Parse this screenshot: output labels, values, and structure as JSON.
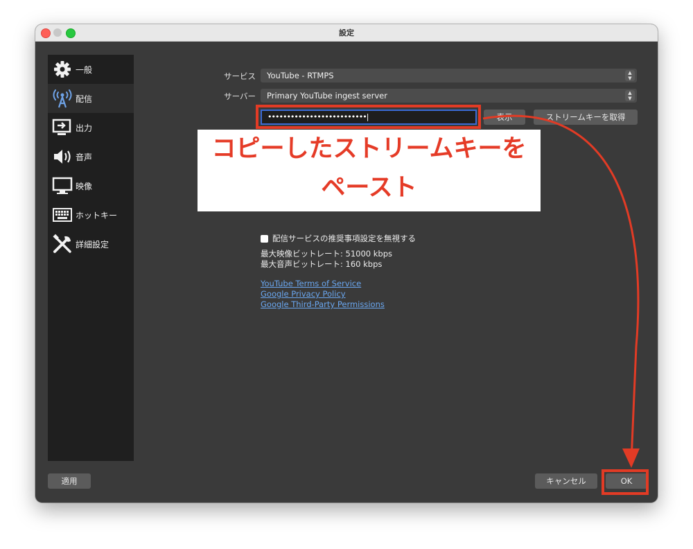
{
  "window": {
    "title": "設定"
  },
  "sidebar": {
    "items": [
      {
        "label": "一般",
        "icon": "gear-icon"
      },
      {
        "label": "配信",
        "icon": "antenna-icon"
      },
      {
        "label": "出力",
        "icon": "output-icon"
      },
      {
        "label": "音声",
        "icon": "speaker-icon"
      },
      {
        "label": "映像",
        "icon": "monitor-icon"
      },
      {
        "label": "ホットキー",
        "icon": "keyboard-icon"
      },
      {
        "label": "詳細設定",
        "icon": "tools-icon"
      }
    ],
    "active_index": 1
  },
  "stream": {
    "service_label": "サービス",
    "service_value": "YouTube - RTMPS",
    "server_label": "サーバー",
    "server_value": "Primary YouTube ingest server",
    "key_value": "••••••••••••••••••••••••••|",
    "show_button": "表示",
    "get_key_button": "ストリームキーを取得",
    "ignore_checkbox_label": "配信サービスの推奨事項設定を無視する",
    "max_video_bitrate": "最大映像ビットレート: 51000 kbps",
    "max_audio_bitrate": "最大音声ビットレート: 160 kbps",
    "links": [
      "YouTube Terms of Service",
      "Google Privacy Policy",
      "Google Third-Party Permissions"
    ]
  },
  "footer": {
    "apply_button": "適用",
    "cancel_button": "キャンセル",
    "ok_button": "OK"
  },
  "annotation": {
    "line1": "コピーしたストリームキーを",
    "line2": "ペースト",
    "color": "#e23b25"
  }
}
